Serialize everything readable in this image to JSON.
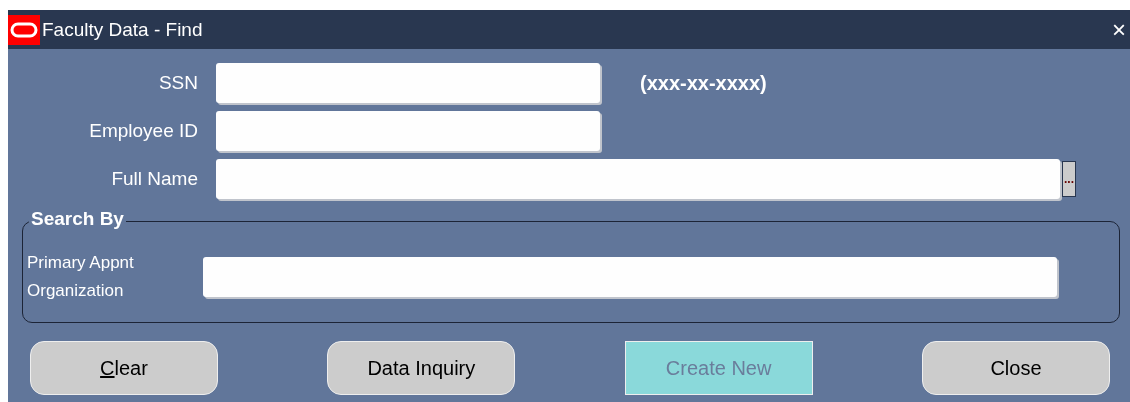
{
  "window": {
    "title": "Faculty Data - Find",
    "close": "×"
  },
  "fields": [
    {
      "label": "SSN",
      "kind": "short",
      "hint_text": "(xxx-xx-xxxx)"
    },
    {
      "label": "Employee ID",
      "kind": "short"
    },
    {
      "label": "Full Name",
      "kind": "lov",
      "lov_button": "..."
    }
  ],
  "search_by": {
    "title": "Search By",
    "fields": [
      {
        "label": "Primary Appnt Organization",
        "kind": "wide"
      }
    ]
  },
  "buttons": [
    {
      "label": "Clear",
      "underline_first": true,
      "disabled": false
    },
    {
      "label": "Data Inquiry",
      "underline_first": false,
      "disabled": false
    },
    {
      "label": "Create New",
      "underline_first": false,
      "disabled": true
    },
    {
      "label": "Close",
      "underline_first": false,
      "disabled": false
    }
  ]
}
